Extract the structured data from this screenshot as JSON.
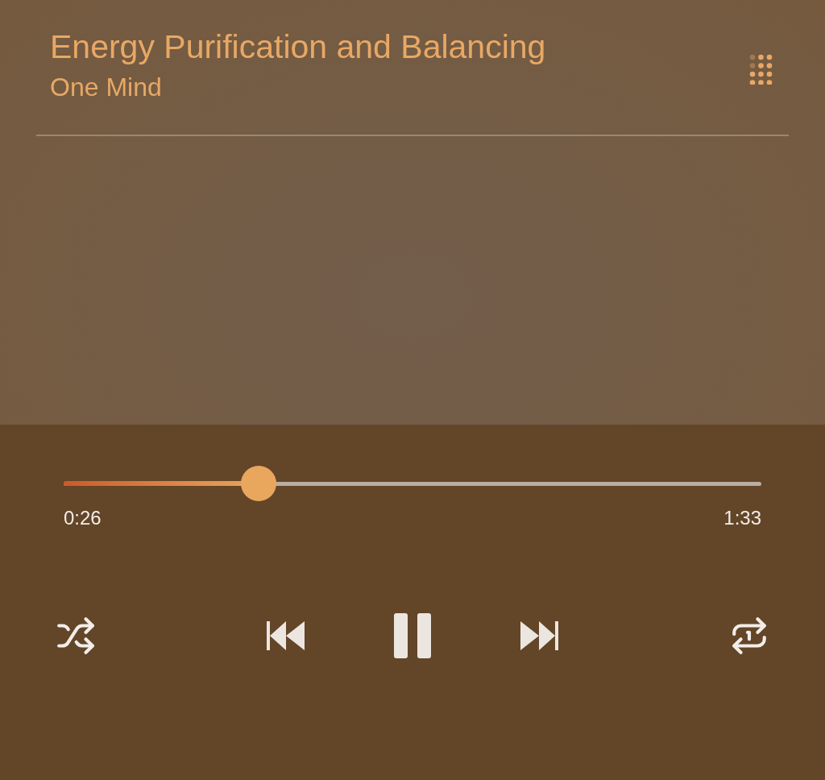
{
  "track": {
    "title": "Energy Purification and Balancing",
    "artist": "One Mind"
  },
  "progress": {
    "level": 0.28,
    "elapsed": "0:26",
    "duration": "1:33"
  },
  "controls": {
    "playing": true
  }
}
